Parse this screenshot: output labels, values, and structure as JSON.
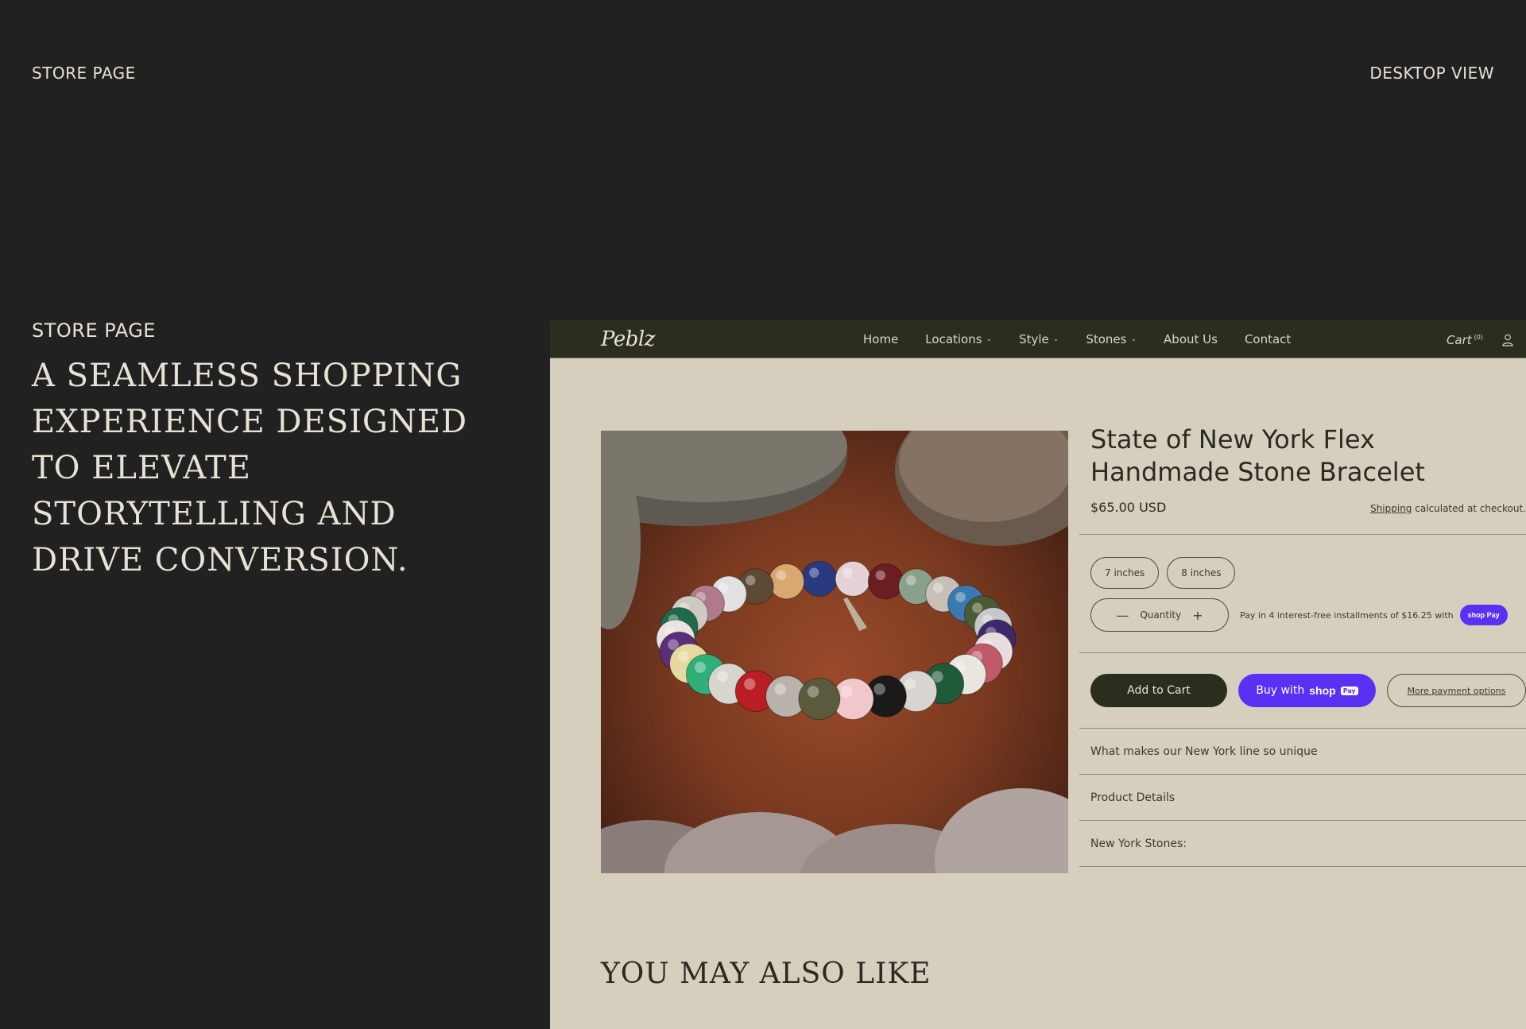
{
  "frame": {
    "left_label": "STORE PAGE",
    "right_label": "DESKTOP VIEW"
  },
  "intro": {
    "eyebrow": "STORE PAGE",
    "headline_lines": [
      "A SEAMLESS SHOPPING",
      "EXPERIENCE DESIGNED",
      "TO ELEVATE",
      "STORYTELLING AND",
      "DRIVE CONVERSION."
    ]
  },
  "store": {
    "logo": "Peblz",
    "nav": [
      {
        "label": "Home",
        "dropdown": false
      },
      {
        "label": "Locations",
        "dropdown": true
      },
      {
        "label": "Style",
        "dropdown": true
      },
      {
        "label": "Stones",
        "dropdown": true
      },
      {
        "label": "About Us",
        "dropdown": false
      },
      {
        "label": "Contact",
        "dropdown": false
      }
    ],
    "cart_label": "Cart",
    "cart_count": "(0)",
    "product": {
      "title_lines": [
        "State of New York Flex",
        "Handmade Stone Bracelet"
      ],
      "price": "$65.00 USD",
      "shipping_link": "Shipping",
      "shipping_text": " calculated at checkout.",
      "sizes": [
        "7 inches",
        "8 inches"
      ],
      "quantity_label": "Quantity",
      "installments_text": "Pay in 4 interest-free installments of $16.25 with",
      "shoppay_badge": "shop Pay",
      "add_to_cart": "Add to Cart",
      "buy_with": "Buy with",
      "buy_shop": "shop",
      "buy_pay": "Pay",
      "more_payment": "More payment options",
      "accordion": [
        "What makes our New York line so unique",
        "Product Details",
        "New York Stones:"
      ]
    },
    "also_like": "YOU MAY ALSO LIKE"
  },
  "colors": {
    "page_bg": "#212121",
    "store_bg": "#d6cfbe",
    "nav_bg": "#2b2d1f",
    "shoppay": "#5a31f4"
  }
}
